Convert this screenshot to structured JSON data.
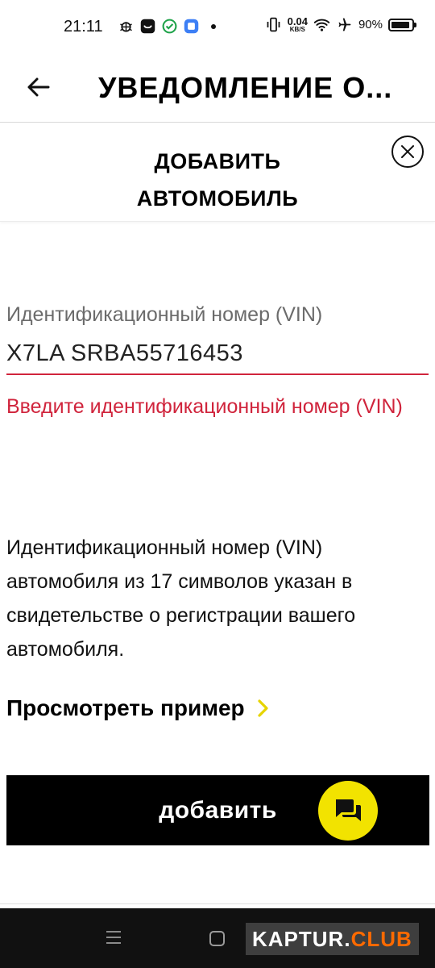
{
  "status_bar": {
    "time": "21:11",
    "net_speed_value": "0.04",
    "net_speed_unit": "KB/S",
    "battery_percent": "90%",
    "battery_level": 0.9
  },
  "header": {
    "title": "УВЕДОМЛЕНИЕ О..."
  },
  "modal": {
    "title_line1": "ДОБАВИТЬ",
    "title_line2": "АВТОМОБИЛЬ"
  },
  "form": {
    "vin_label": "Идентификационный номер (VIN)",
    "vin_value": "X7LA SRBA55716453",
    "vin_error": "Введите идентификационный номер (VIN)",
    "help_text": "Идентификационный номер (VIN) автомобиля из 17 символов указан в свидетельстве о регистрации вашего автомобиля.",
    "example_link": "Просмотреть пример",
    "submit_label": "добавить"
  },
  "watermark": {
    "part1": "KAPTUR.",
    "part2": "CLUB"
  },
  "colors": {
    "error": "#d0243c",
    "accent_yellow": "#f2e300",
    "button_bg": "#000000"
  }
}
